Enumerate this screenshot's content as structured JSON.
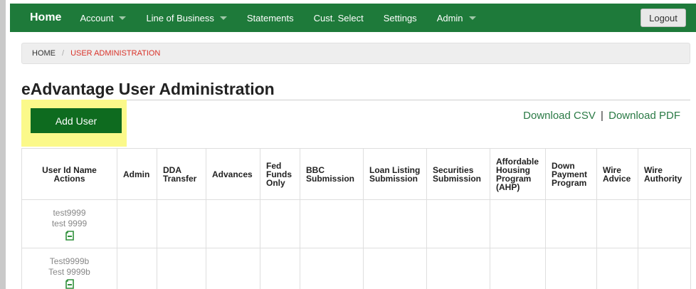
{
  "nav": {
    "home": "Home",
    "items": [
      {
        "label": "Account",
        "dropdown": true
      },
      {
        "label": "Line of Business",
        "dropdown": true
      },
      {
        "label": "Statements",
        "dropdown": false
      },
      {
        "label": "Cust. Select",
        "dropdown": false
      },
      {
        "label": "Settings",
        "dropdown": false
      },
      {
        "label": "Admin",
        "dropdown": true
      }
    ],
    "logout": "Logout"
  },
  "breadcrumb": {
    "home": "HOME",
    "separator": "/",
    "current": "USER ADMINISTRATION"
  },
  "page": {
    "title": "eAdvantage User Administration",
    "add_user": "Add User",
    "download_csv": "Download CSV",
    "download_separator": "|",
    "download_pdf": "Download PDF"
  },
  "table": {
    "headers": [
      "User Id Name Actions",
      "Admin",
      "DDA Transfer",
      "Advances",
      "Fed Funds Only",
      "BBC Submission",
      "Loan Listing Submission",
      "Securities Submission",
      "Affordable Housing Program (AHP)",
      "Down Payment Program",
      "Wire Advice",
      "Wire Authority"
    ],
    "rows": [
      {
        "user_id": "test9999",
        "name": "test 9999",
        "action_icon": "edit-document-icon"
      },
      {
        "user_id": "Test9999b",
        "name": "Test 9999b",
        "action_icon": "edit-document-icon"
      }
    ]
  },
  "colors": {
    "nav_bg": "#1e7a3a",
    "add_user_bg": "#0e6b1f",
    "highlight": "#fbf98a",
    "breadcrumb_current": "#d9332a",
    "download_link": "#2a7a45"
  }
}
